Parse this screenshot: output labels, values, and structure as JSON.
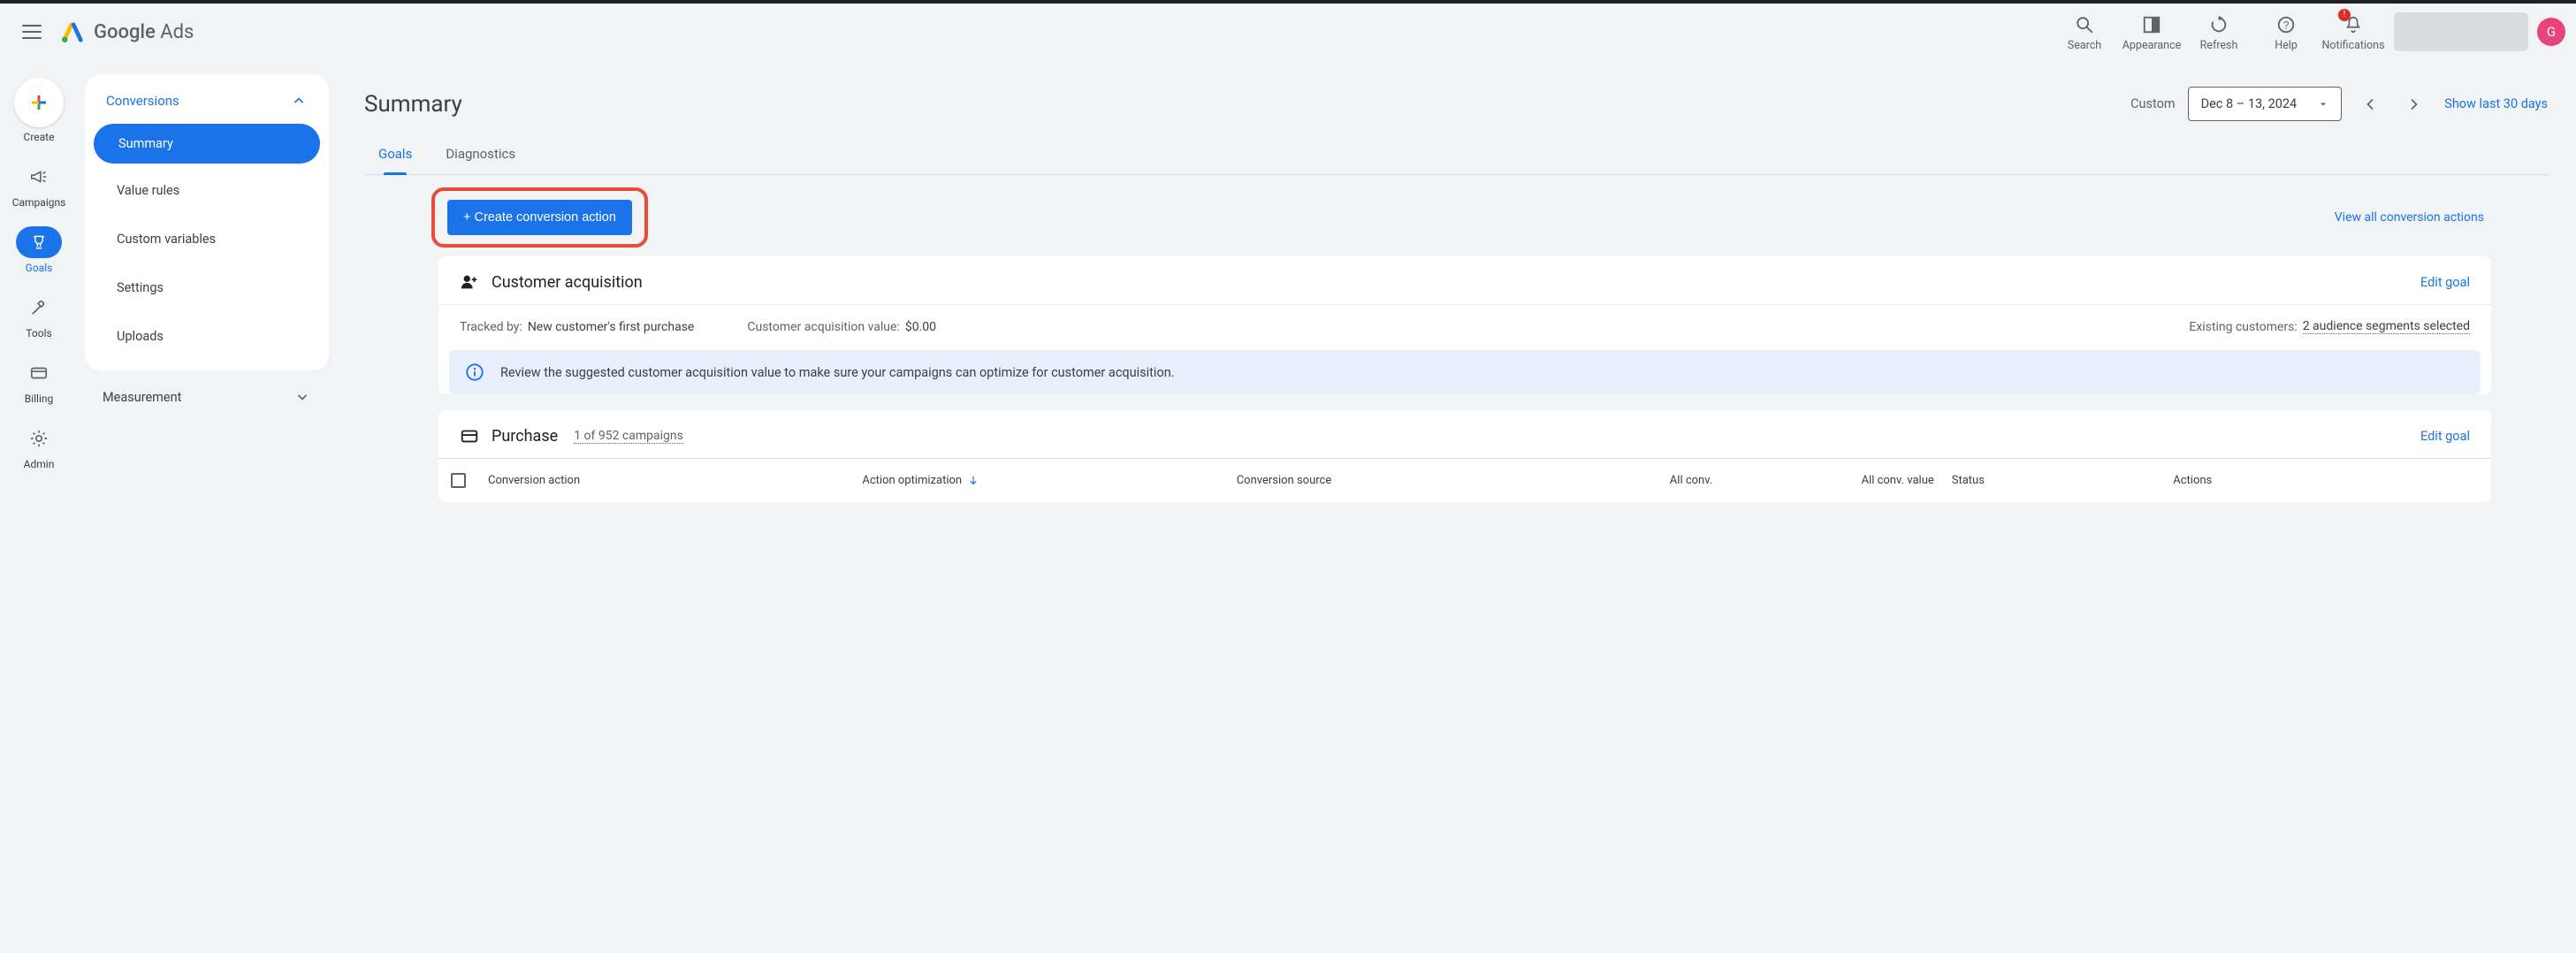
{
  "topbar": {
    "logo_text_bold": "Google",
    "logo_text_light": "Ads",
    "actions": {
      "search": "Search",
      "appearance": "Appearance",
      "refresh": "Refresh",
      "help": "Help",
      "notifications": "Notifications",
      "notif_badge": "!"
    },
    "avatar_letter": "G"
  },
  "left_rail": {
    "create": "Create",
    "campaigns": "Campaigns",
    "goals": "Goals",
    "tools": "Tools",
    "billing": "Billing",
    "admin": "Admin"
  },
  "sidebar": {
    "conversions": {
      "title": "Conversions",
      "items": {
        "summary": "Summary",
        "value_rules": "Value rules",
        "custom_variables": "Custom variables",
        "settings": "Settings",
        "uploads": "Uploads"
      }
    },
    "measurement": "Measurement"
  },
  "header": {
    "title": "Summary",
    "date_mode": "Custom",
    "date_range": "Dec 8 – 13, 2024",
    "show_last_30": "Show last 30 days"
  },
  "tabs": {
    "goals": "Goals",
    "diagnostics": "Diagnostics"
  },
  "action_bar": {
    "create_button": "+ Create conversion action",
    "view_all": "View all conversion actions"
  },
  "card_customer_acq": {
    "title": "Customer acquisition",
    "edit": "Edit goal",
    "tracked_by_label": "Tracked by:",
    "tracked_by_value": "New customer's first purchase",
    "acq_value_label": "Customer acquisition value:",
    "acq_value_value": "$0.00",
    "existing_label": "Existing customers:",
    "existing_value": "2 audience segments selected",
    "banner": "Review the suggested customer acquisition value to make sure your campaigns can optimize for customer acquisition."
  },
  "card_purchase": {
    "title": "Purchase",
    "campaigns_link": "1 of 952 campaigns",
    "edit": "Edit goal",
    "columns": {
      "conversion_action": "Conversion action",
      "action_optimization": "Action optimization",
      "conversion_source": "Conversion source",
      "all_conv": "All conv.",
      "all_conv_value": "All conv. value",
      "status": "Status",
      "actions": "Actions"
    }
  }
}
